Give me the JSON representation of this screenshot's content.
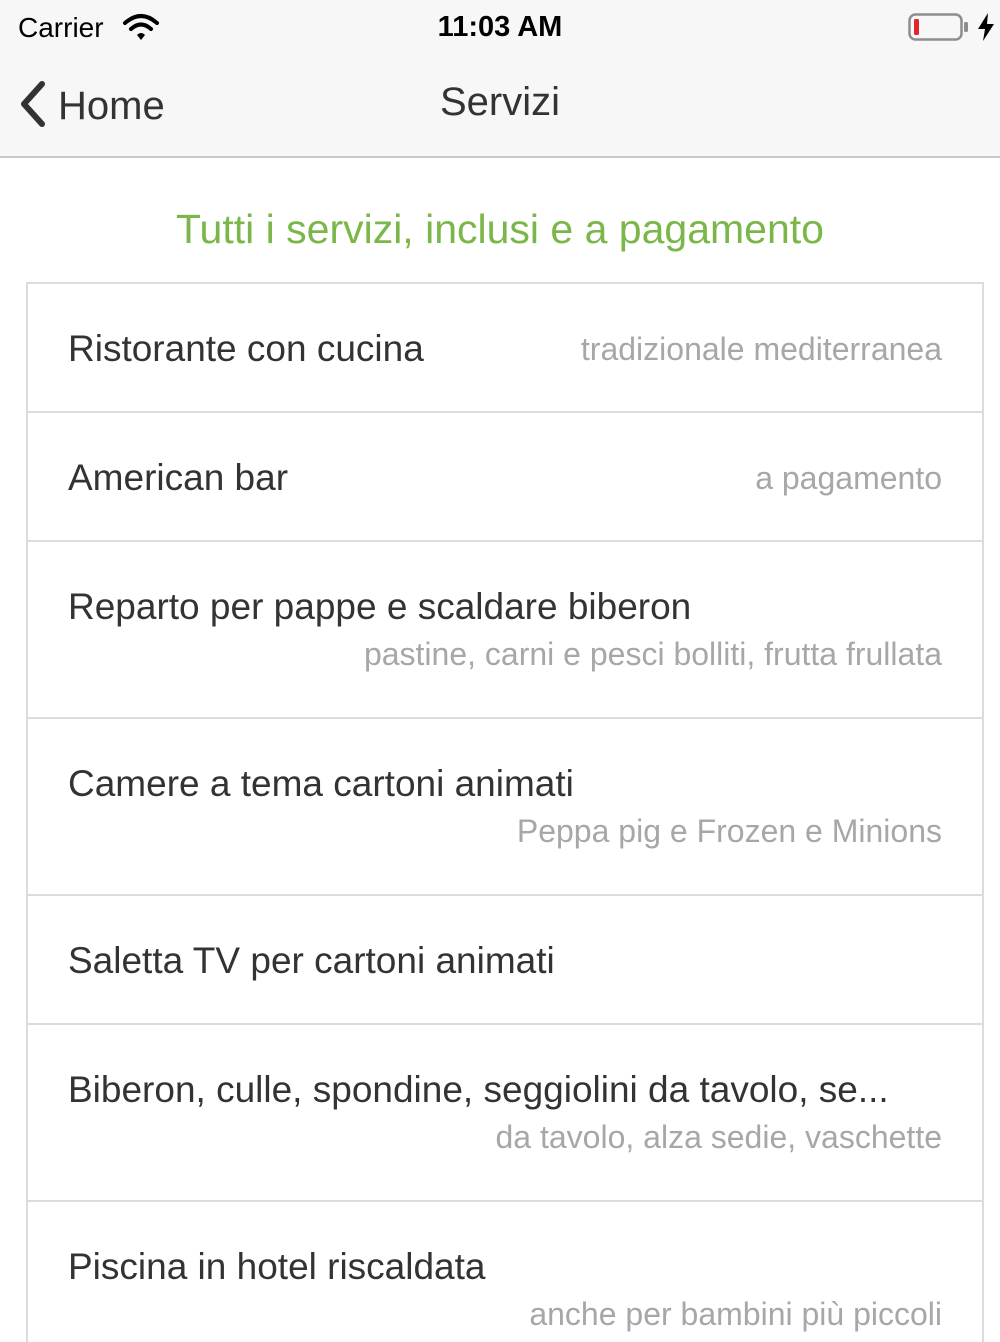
{
  "status_bar": {
    "carrier": "Carrier",
    "time": "11:03 AM",
    "wifi_icon": "wifi-icon",
    "battery_icon": "battery-low-icon",
    "charging_icon": "charging-bolt-icon"
  },
  "nav": {
    "back_label": "Home",
    "back_icon": "chevron-left-icon",
    "title": "Servizi"
  },
  "section": {
    "header": "Tutti i servizi, inclusi e a pagamento",
    "accent_color": "#7ab648"
  },
  "services": [
    {
      "title": "Ristorante con cucina",
      "detail": "tradizionale mediterranea"
    },
    {
      "title": "American bar",
      "detail": "a pagamento"
    },
    {
      "title": "Reparto per pappe e scaldare biberon",
      "detail": "pastine, carni e pesci bolliti, frutta frullata"
    },
    {
      "title": "Camere a tema cartoni animati",
      "detail": "Peppa pig e Frozen e Minions"
    },
    {
      "title": "Saletta TV per cartoni animati",
      "detail": ""
    },
    {
      "title": "Biberon, culle, spondine, seggiolini da tavolo, se...",
      "detail": "da tavolo, alza sedie, vaschette"
    },
    {
      "title": "Piscina in hotel riscaldata",
      "detail": "anche per bambini più piccoli"
    }
  ]
}
